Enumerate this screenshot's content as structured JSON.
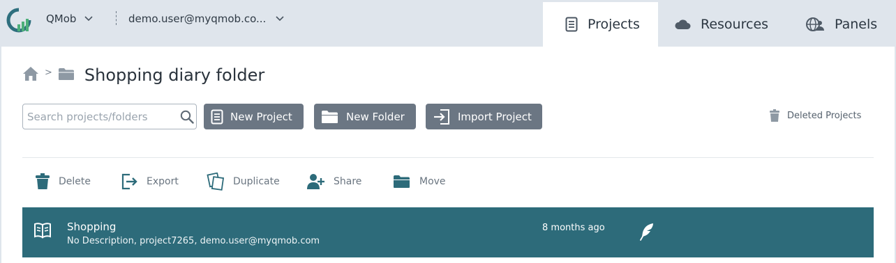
{
  "header": {
    "logo_icon": "qmob-logo-icon",
    "org_name": "QMob",
    "user_email": "demo.user@myqmob.co...",
    "tabs": [
      {
        "label": "Projects",
        "icon": "document-icon",
        "active": true
      },
      {
        "label": "Resources",
        "icon": "cloud-icon",
        "active": false
      },
      {
        "label": "Panels",
        "icon": "globe-people-icon",
        "active": false
      }
    ]
  },
  "breadcrumb": {
    "home_icon": "home-icon",
    "separator": ">",
    "folder_icon": "folder-icon",
    "title": "Shopping diary folder"
  },
  "toolbar": {
    "search_placeholder": "Search projects/folders",
    "search_value": "",
    "new_project_label": "New Project",
    "new_folder_label": "New Folder",
    "import_project_label": "Import Project",
    "deleted_projects_label": "Deleted Projects"
  },
  "actions": {
    "delete_label": "Delete",
    "export_label": "Export",
    "duplicate_label": "Duplicate",
    "share_label": "Share",
    "move_label": "Move"
  },
  "projects": [
    {
      "name": "Shopping",
      "description": "No Description, project7265, demo.user@myqmob.com",
      "modified": "8 months ago",
      "icon": "book-icon",
      "status_icon": "feather-icon"
    }
  ],
  "colors": {
    "topbar_bg": "#dfe5ec",
    "button_bg": "#6b7683",
    "row_selected_bg": "#2d6b7a",
    "brand_teal": "#2e6f7e",
    "brand_green": "#4caf7a"
  }
}
